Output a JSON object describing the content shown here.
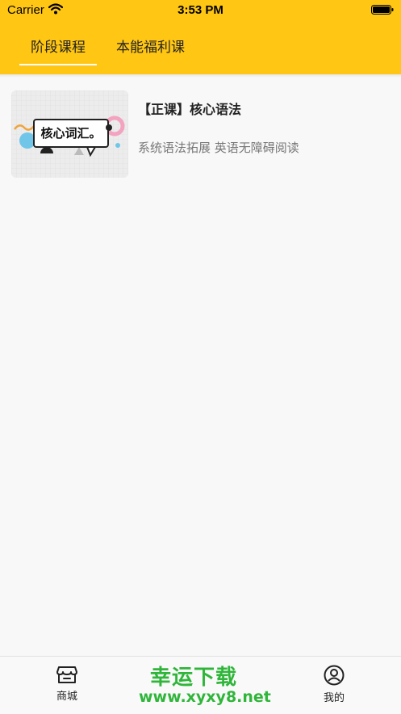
{
  "status_bar": {
    "carrier": "Carrier",
    "time": "3:53 PM"
  },
  "tabs": [
    {
      "label": "阶段课程",
      "active": true
    },
    {
      "label": "本能福利课",
      "active": false
    }
  ],
  "courses": [
    {
      "thumbnail_text": "核心词汇。",
      "title": "【正课】核心语法",
      "subtitle": "系统语法拓展 英语无障碍阅读"
    }
  ],
  "bottom_nav": {
    "shop": {
      "label": "商城",
      "icon": "store-icon"
    },
    "mine": {
      "label": "我的",
      "icon": "user-circle-icon"
    }
  },
  "watermark": {
    "text": "幸运下载",
    "url": "www.xyxy8.net"
  },
  "colors": {
    "header": "#ffc613",
    "background": "#f8f8f8",
    "watermark": "#2fb63a"
  }
}
